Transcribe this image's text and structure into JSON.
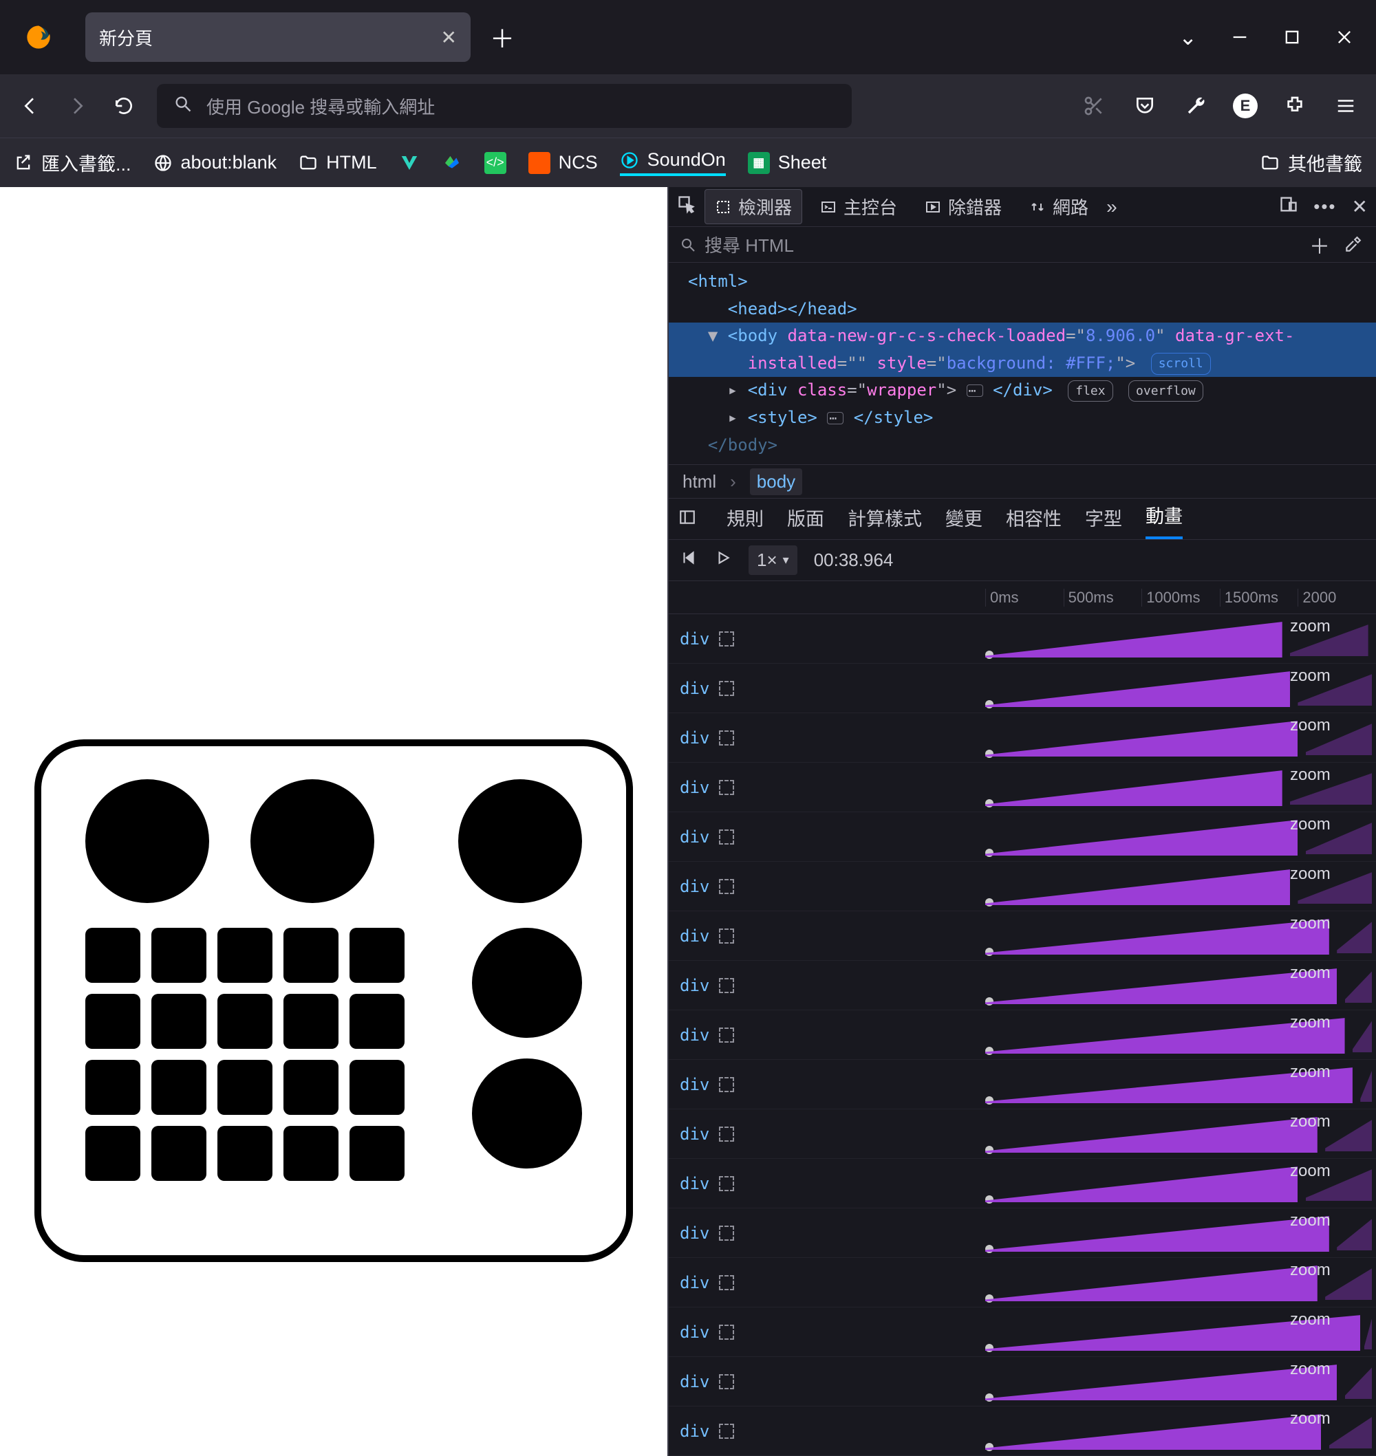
{
  "tab": {
    "title": "新分頁"
  },
  "urlbar": {
    "placeholder": "使用 Google 搜尋或輸入網址"
  },
  "ext_badge": "E",
  "bookmarks": {
    "import": "匯入書籤...",
    "about": "about:blank",
    "html": "HTML",
    "ncs": "NCS",
    "soundon": "SoundOn",
    "sheet": "Sheet",
    "other": "其他書籤"
  },
  "devtools": {
    "tabs": {
      "inspector": "檢測器",
      "console": "主控台",
      "debugger": "除錯器",
      "network": "網路"
    },
    "search_placeholder": "搜尋 HTML",
    "dom": {
      "l0": "<html>",
      "l1": "  <head></head>",
      "l2a": "<body ",
      "l2b": "data-new-gr-c-s-check-loaded",
      "l2c": "=\"",
      "l2d": "8.906.0",
      "l2e": "\" ",
      "l2f": "data-gr-ext-",
      "l3a": "installed",
      "l3b": "=\"\" ",
      "l3c": "style",
      "l3d": "=\"",
      "l3e": "background: #FFF;",
      "l3f": "\">",
      "l4a": "<div ",
      "l4b": "class",
      "l4c": "=\"",
      "l4d": "wrapper",
      "l4e": "\">",
      "l4f": "</div>",
      "l5a": "<style>",
      "l5b": "</style>",
      "l6": "</body>",
      "pill_scroll": "scroll",
      "pill_flex": "flex",
      "pill_overflow": "overflow"
    },
    "crumb_html": "html",
    "crumb_body": "body",
    "subtabs": {
      "rules": "規則",
      "layout": "版面",
      "computed": "計算樣式",
      "changes": "變更",
      "compat": "相容性",
      "fonts": "字型",
      "animations": "動畫"
    },
    "anim": {
      "speed": "1×",
      "time": "00:38.964",
      "ticks": [
        "0ms",
        "500ms",
        "1000ms",
        "1500ms",
        "2000"
      ],
      "row_node": "div",
      "row_name": "zoom",
      "rows": [
        {
          "mainWidth": 76,
          "echoLeft": 78,
          "echoWidth": 20,
          "nameLeft": 78
        },
        {
          "mainWidth": 78,
          "echoLeft": 80,
          "echoWidth": 19,
          "nameLeft": 78
        },
        {
          "mainWidth": 80,
          "echoLeft": 82,
          "echoWidth": 17,
          "nameLeft": 78
        },
        {
          "mainWidth": 76,
          "echoLeft": 78,
          "echoWidth": 21,
          "nameLeft": 78
        },
        {
          "mainWidth": 80,
          "echoLeft": 82,
          "echoWidth": 17,
          "nameLeft": 78
        },
        {
          "mainWidth": 78,
          "echoLeft": 80,
          "echoWidth": 19,
          "nameLeft": 78
        },
        {
          "mainWidth": 88,
          "echoLeft": 90,
          "echoWidth": 9,
          "nameLeft": 78
        },
        {
          "mainWidth": 90,
          "echoLeft": 92,
          "echoWidth": 7,
          "nameLeft": 78
        },
        {
          "mainWidth": 92,
          "echoLeft": 94,
          "echoWidth": 5,
          "nameLeft": 78
        },
        {
          "mainWidth": 94,
          "echoLeft": 96,
          "echoWidth": 3,
          "nameLeft": 78
        },
        {
          "mainWidth": 85,
          "echoLeft": 87,
          "echoWidth": 12,
          "nameLeft": 78
        },
        {
          "mainWidth": 80,
          "echoLeft": 82,
          "echoWidth": 17,
          "nameLeft": 78
        },
        {
          "mainWidth": 88,
          "echoLeft": 90,
          "echoWidth": 9,
          "nameLeft": 78
        },
        {
          "mainWidth": 85,
          "echoLeft": 87,
          "echoWidth": 12,
          "nameLeft": 78
        },
        {
          "mainWidth": 96,
          "echoLeft": 97,
          "echoWidth": 2,
          "nameLeft": 78
        },
        {
          "mainWidth": 90,
          "echoLeft": 92,
          "echoWidth": 7,
          "nameLeft": 78
        },
        {
          "mainWidth": 86,
          "echoLeft": 88,
          "echoWidth": 11,
          "nameLeft": 78
        }
      ]
    }
  }
}
